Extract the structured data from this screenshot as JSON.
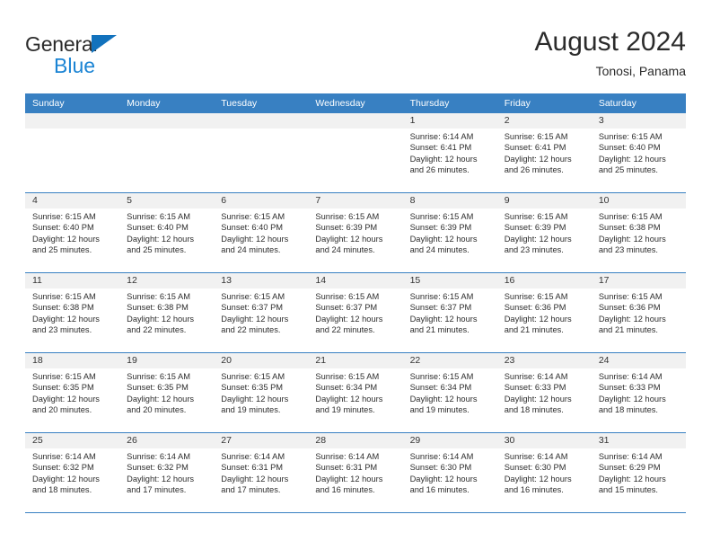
{
  "brand": {
    "name_part1": "General",
    "name_part2": "Blue",
    "triangle_color": "#1272bd",
    "blue_color": "#1b84d4"
  },
  "header": {
    "title": "August 2024",
    "subtitle": "Tonosi, Panama"
  },
  "theme": {
    "header_blue": "#3880c2",
    "daynum_band": "#f1f1f1",
    "text": "#2d2d2d"
  },
  "weekday_headers": [
    "Sunday",
    "Monday",
    "Tuesday",
    "Wednesday",
    "Thursday",
    "Friday",
    "Saturday"
  ],
  "weeks": [
    [
      {
        "day": "",
        "sunrise": "",
        "sunset": "",
        "daylight_line1": "",
        "daylight_line2": ""
      },
      {
        "day": "",
        "sunrise": "",
        "sunset": "",
        "daylight_line1": "",
        "daylight_line2": ""
      },
      {
        "day": "",
        "sunrise": "",
        "sunset": "",
        "daylight_line1": "",
        "daylight_line2": ""
      },
      {
        "day": "",
        "sunrise": "",
        "sunset": "",
        "daylight_line1": "",
        "daylight_line2": ""
      },
      {
        "day": "1",
        "sunrise": "Sunrise: 6:14 AM",
        "sunset": "Sunset: 6:41 PM",
        "daylight_line1": "Daylight: 12 hours",
        "daylight_line2": "and 26 minutes."
      },
      {
        "day": "2",
        "sunrise": "Sunrise: 6:15 AM",
        "sunset": "Sunset: 6:41 PM",
        "daylight_line1": "Daylight: 12 hours",
        "daylight_line2": "and 26 minutes."
      },
      {
        "day": "3",
        "sunrise": "Sunrise: 6:15 AM",
        "sunset": "Sunset: 6:40 PM",
        "daylight_line1": "Daylight: 12 hours",
        "daylight_line2": "and 25 minutes."
      }
    ],
    [
      {
        "day": "4",
        "sunrise": "Sunrise: 6:15 AM",
        "sunset": "Sunset: 6:40 PM",
        "daylight_line1": "Daylight: 12 hours",
        "daylight_line2": "and 25 minutes."
      },
      {
        "day": "5",
        "sunrise": "Sunrise: 6:15 AM",
        "sunset": "Sunset: 6:40 PM",
        "daylight_line1": "Daylight: 12 hours",
        "daylight_line2": "and 25 minutes."
      },
      {
        "day": "6",
        "sunrise": "Sunrise: 6:15 AM",
        "sunset": "Sunset: 6:40 PM",
        "daylight_line1": "Daylight: 12 hours",
        "daylight_line2": "and 24 minutes."
      },
      {
        "day": "7",
        "sunrise": "Sunrise: 6:15 AM",
        "sunset": "Sunset: 6:39 PM",
        "daylight_line1": "Daylight: 12 hours",
        "daylight_line2": "and 24 minutes."
      },
      {
        "day": "8",
        "sunrise": "Sunrise: 6:15 AM",
        "sunset": "Sunset: 6:39 PM",
        "daylight_line1": "Daylight: 12 hours",
        "daylight_line2": "and 24 minutes."
      },
      {
        "day": "9",
        "sunrise": "Sunrise: 6:15 AM",
        "sunset": "Sunset: 6:39 PM",
        "daylight_line1": "Daylight: 12 hours",
        "daylight_line2": "and 23 minutes."
      },
      {
        "day": "10",
        "sunrise": "Sunrise: 6:15 AM",
        "sunset": "Sunset: 6:38 PM",
        "daylight_line1": "Daylight: 12 hours",
        "daylight_line2": "and 23 minutes."
      }
    ],
    [
      {
        "day": "11",
        "sunrise": "Sunrise: 6:15 AM",
        "sunset": "Sunset: 6:38 PM",
        "daylight_line1": "Daylight: 12 hours",
        "daylight_line2": "and 23 minutes."
      },
      {
        "day": "12",
        "sunrise": "Sunrise: 6:15 AM",
        "sunset": "Sunset: 6:38 PM",
        "daylight_line1": "Daylight: 12 hours",
        "daylight_line2": "and 22 minutes."
      },
      {
        "day": "13",
        "sunrise": "Sunrise: 6:15 AM",
        "sunset": "Sunset: 6:37 PM",
        "daylight_line1": "Daylight: 12 hours",
        "daylight_line2": "and 22 minutes."
      },
      {
        "day": "14",
        "sunrise": "Sunrise: 6:15 AM",
        "sunset": "Sunset: 6:37 PM",
        "daylight_line1": "Daylight: 12 hours",
        "daylight_line2": "and 22 minutes."
      },
      {
        "day": "15",
        "sunrise": "Sunrise: 6:15 AM",
        "sunset": "Sunset: 6:37 PM",
        "daylight_line1": "Daylight: 12 hours",
        "daylight_line2": "and 21 minutes."
      },
      {
        "day": "16",
        "sunrise": "Sunrise: 6:15 AM",
        "sunset": "Sunset: 6:36 PM",
        "daylight_line1": "Daylight: 12 hours",
        "daylight_line2": "and 21 minutes."
      },
      {
        "day": "17",
        "sunrise": "Sunrise: 6:15 AM",
        "sunset": "Sunset: 6:36 PM",
        "daylight_line1": "Daylight: 12 hours",
        "daylight_line2": "and 21 minutes."
      }
    ],
    [
      {
        "day": "18",
        "sunrise": "Sunrise: 6:15 AM",
        "sunset": "Sunset: 6:35 PM",
        "daylight_line1": "Daylight: 12 hours",
        "daylight_line2": "and 20 minutes."
      },
      {
        "day": "19",
        "sunrise": "Sunrise: 6:15 AM",
        "sunset": "Sunset: 6:35 PM",
        "daylight_line1": "Daylight: 12 hours",
        "daylight_line2": "and 20 minutes."
      },
      {
        "day": "20",
        "sunrise": "Sunrise: 6:15 AM",
        "sunset": "Sunset: 6:35 PM",
        "daylight_line1": "Daylight: 12 hours",
        "daylight_line2": "and 19 minutes."
      },
      {
        "day": "21",
        "sunrise": "Sunrise: 6:15 AM",
        "sunset": "Sunset: 6:34 PM",
        "daylight_line1": "Daylight: 12 hours",
        "daylight_line2": "and 19 minutes."
      },
      {
        "day": "22",
        "sunrise": "Sunrise: 6:15 AM",
        "sunset": "Sunset: 6:34 PM",
        "daylight_line1": "Daylight: 12 hours",
        "daylight_line2": "and 19 minutes."
      },
      {
        "day": "23",
        "sunrise": "Sunrise: 6:14 AM",
        "sunset": "Sunset: 6:33 PM",
        "daylight_line1": "Daylight: 12 hours",
        "daylight_line2": "and 18 minutes."
      },
      {
        "day": "24",
        "sunrise": "Sunrise: 6:14 AM",
        "sunset": "Sunset: 6:33 PM",
        "daylight_line1": "Daylight: 12 hours",
        "daylight_line2": "and 18 minutes."
      }
    ],
    [
      {
        "day": "25",
        "sunrise": "Sunrise: 6:14 AM",
        "sunset": "Sunset: 6:32 PM",
        "daylight_line1": "Daylight: 12 hours",
        "daylight_line2": "and 18 minutes."
      },
      {
        "day": "26",
        "sunrise": "Sunrise: 6:14 AM",
        "sunset": "Sunset: 6:32 PM",
        "daylight_line1": "Daylight: 12 hours",
        "daylight_line2": "and 17 minutes."
      },
      {
        "day": "27",
        "sunrise": "Sunrise: 6:14 AM",
        "sunset": "Sunset: 6:31 PM",
        "daylight_line1": "Daylight: 12 hours",
        "daylight_line2": "and 17 minutes."
      },
      {
        "day": "28",
        "sunrise": "Sunrise: 6:14 AM",
        "sunset": "Sunset: 6:31 PM",
        "daylight_line1": "Daylight: 12 hours",
        "daylight_line2": "and 16 minutes."
      },
      {
        "day": "29",
        "sunrise": "Sunrise: 6:14 AM",
        "sunset": "Sunset: 6:30 PM",
        "daylight_line1": "Daylight: 12 hours",
        "daylight_line2": "and 16 minutes."
      },
      {
        "day": "30",
        "sunrise": "Sunrise: 6:14 AM",
        "sunset": "Sunset: 6:30 PM",
        "daylight_line1": "Daylight: 12 hours",
        "daylight_line2": "and 16 minutes."
      },
      {
        "day": "31",
        "sunrise": "Sunrise: 6:14 AM",
        "sunset": "Sunset: 6:29 PM",
        "daylight_line1": "Daylight: 12 hours",
        "daylight_line2": "and 15 minutes."
      }
    ]
  ]
}
